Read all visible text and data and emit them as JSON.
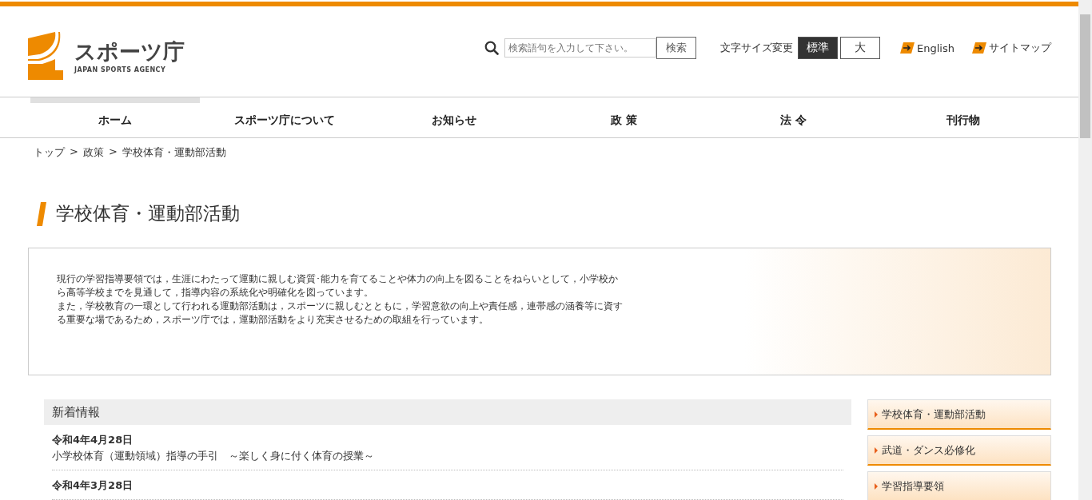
{
  "logo": {
    "name": "スポーツ庁",
    "subtitle": "JAPAN SPORTS AGENCY"
  },
  "search": {
    "placeholder": "検索語句を入力して下さい。",
    "button": "検索"
  },
  "font_size": {
    "label": "文字サイズ変更",
    "options": [
      {
        "label": "標準",
        "selected": true
      },
      {
        "label": "大",
        "selected": false
      }
    ]
  },
  "header_links": [
    "English",
    "サイトマップ"
  ],
  "nav": [
    {
      "label": "ホーム",
      "selected": true
    },
    {
      "label": "スポーツ庁について",
      "selected": false
    },
    {
      "label": "お知らせ",
      "selected": false
    },
    {
      "label": "政 策",
      "selected": false
    },
    {
      "label": "法 令",
      "selected": false
    },
    {
      "label": "刊行物",
      "selected": false
    }
  ],
  "breadcrumb": [
    "トップ",
    "政策",
    "学校体育・運動部活動"
  ],
  "breadcrumb_separator": ">",
  "page_title": "学校体育・運動部活動",
  "intro": [
    "現行の学習指導要領では，生涯にわたって運動に親しむ資質･能力を育てることや体力の向上を図ることをねらいとして，小学校から高等学校までを見通して，指導内容の系統化や明確化を図っています。",
    "また，学校教育の一環として行われる運動部活動は，スポーツに親しむとともに，学習意欲の向上や責任感，連帯感の涵養等に資する重要な場であるため，スポーツ庁では，運動部活動をより充実させるための取組を行っています。"
  ],
  "news": {
    "heading": "新着情報",
    "items": [
      {
        "date": "令和4年4月28日",
        "title": "小学校体育（運動領域）指導の手引　～楽しく身に付く体育の授業～"
      },
      {
        "date": "令和4年3月28日"
      }
    ]
  },
  "side_menu": [
    "学校体育・運動部活動",
    "武道・ダンス必修化",
    "学習指導要領"
  ]
}
